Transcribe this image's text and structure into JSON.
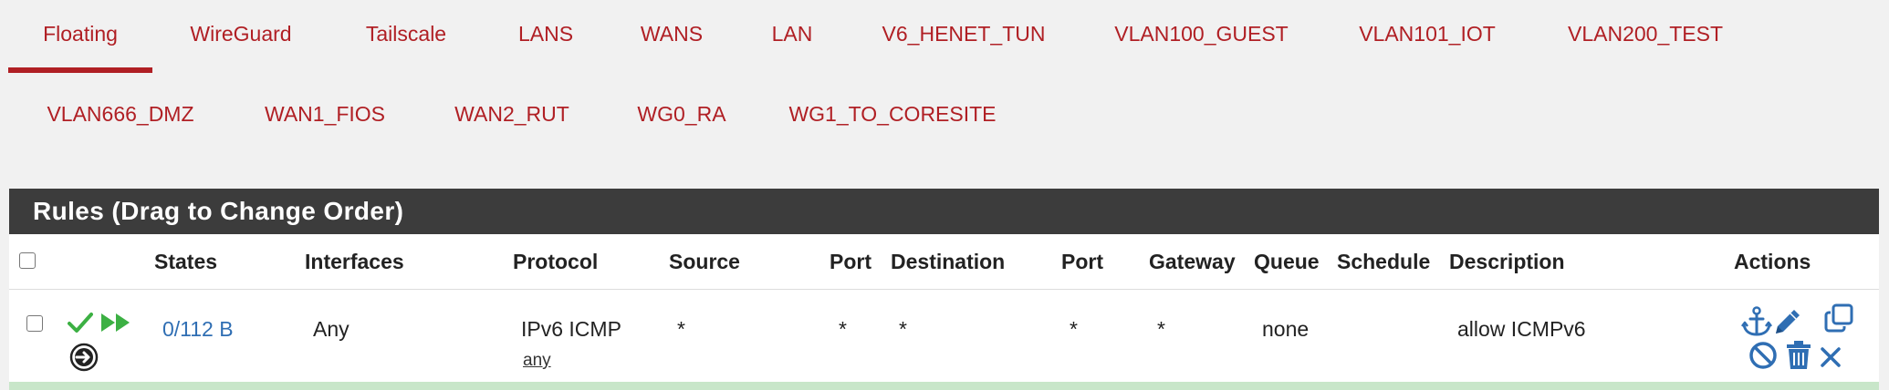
{
  "tabs": [
    {
      "label": "Floating",
      "active": true
    },
    {
      "label": "WireGuard"
    },
    {
      "label": "Tailscale"
    },
    {
      "label": "LANS"
    },
    {
      "label": "WANS"
    },
    {
      "label": "LAN"
    },
    {
      "label": "V6_HENET_TUN"
    },
    {
      "label": "VLAN100_GUEST"
    },
    {
      "label": "VLAN101_IOT"
    },
    {
      "label": "VLAN200_TEST"
    },
    {
      "label": "VLAN666_DMZ"
    },
    {
      "label": "WAN1_FIOS"
    },
    {
      "label": "WAN2_RUT"
    },
    {
      "label": "WG0_RA"
    },
    {
      "label": "WG1_TO_CORESITE"
    }
  ],
  "panel": {
    "title": "Rules (Drag to Change Order)",
    "columns": {
      "states": "States",
      "interfaces": "Interfaces",
      "protocol": "Protocol",
      "source": "Source",
      "source_port": "Port",
      "destination": "Destination",
      "destination_port": "Port",
      "gateway": "Gateway",
      "queue": "Queue",
      "schedule": "Schedule",
      "description": "Description",
      "actions": "Actions"
    },
    "rules": [
      {
        "states": "0/112 B",
        "interfaces": "Any",
        "protocol": "IPv6 ICMP",
        "protocol_detail": "any",
        "source": "*",
        "source_port": "*",
        "destination": "*",
        "destination_port": "*",
        "gateway": "*",
        "queue": "none",
        "schedule": "",
        "description": "allow ICMPv6",
        "status_icons": [
          "check-icon",
          "fast-forward-icon",
          "arrow-circle-right-icon"
        ],
        "action_icons": [
          "anchor-icon",
          "pencil-icon",
          "copy-icon",
          "disable-icon",
          "trash-icon",
          "close-icon"
        ]
      }
    ]
  },
  "colors": {
    "tab_text": "#b01f24",
    "header_bg": "#3c3c3c",
    "link": "#2f6eb3",
    "pass_green": "#3cb043",
    "row_highlight": "#c8e6c9",
    "icon_blue": "#2f6eb3"
  }
}
